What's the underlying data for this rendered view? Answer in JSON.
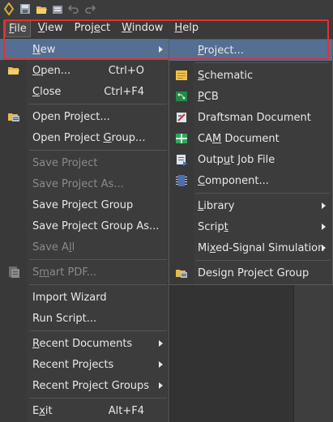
{
  "menubar": {
    "items": [
      {
        "pre": "",
        "u": "F",
        "post": "ile"
      },
      {
        "pre": "",
        "u": "V",
        "post": "iew"
      },
      {
        "pre": "Proj",
        "u": "e",
        "post": "ct"
      },
      {
        "pre": "",
        "u": "W",
        "post": "indow"
      },
      {
        "pre": "",
        "u": "H",
        "post": "elp"
      }
    ]
  },
  "file_menu": {
    "new": {
      "pre": "",
      "u": "N",
      "post": "ew"
    },
    "open": {
      "pre": "",
      "u": "O",
      "post": "pen...",
      "shortcut": "Ctrl+O"
    },
    "close": {
      "pre": "",
      "u": "C",
      "post": "lose",
      "shortcut": "Ctrl+F4"
    },
    "open_project": {
      "pre": "Open Pro",
      "u": "j",
      "post": "ect..."
    },
    "open_project_group": {
      "pre": "Open Project ",
      "u": "G",
      "post": "roup..."
    },
    "save_project": {
      "pre": "Save Project",
      "u": "",
      "post": ""
    },
    "save_project_as": {
      "pre": "Save Project As...",
      "u": "",
      "post": ""
    },
    "save_project_group": {
      "pre": "Save Project Group",
      "u": "",
      "post": ""
    },
    "save_project_group_as": {
      "pre": "Save Project Group As...",
      "u": "",
      "post": ""
    },
    "save_all": {
      "pre": "Save A",
      "u": "l",
      "post": "l"
    },
    "smart_pdf": {
      "pre": "S",
      "u": "m",
      "post": "art PDF..."
    },
    "import_wizard": {
      "pre": "Import Wizard",
      "u": "",
      "post": ""
    },
    "run_script": {
      "pre": "Run Script...",
      "u": "",
      "post": ""
    },
    "recent_documents": {
      "pre": "",
      "u": "R",
      "post": "ecent Documents"
    },
    "recent_projects": {
      "pre": "Recent Pro",
      "u": "j",
      "post": "ects"
    },
    "recent_project_groups": {
      "pre": "Recent Pro",
      "u": "j",
      "post": "ect Groups"
    },
    "exit": {
      "pre": "E",
      "u": "x",
      "post": "it",
      "shortcut": "Alt+F4"
    }
  },
  "new_submenu": {
    "project": {
      "pre": "",
      "u": "P",
      "post": "roject..."
    },
    "schematic": {
      "pre": "",
      "u": "S",
      "post": "chematic"
    },
    "pcb": {
      "pre": "",
      "u": "P",
      "post": "CB"
    },
    "draftsman": {
      "pre": "Draftsman Document",
      "u": "",
      "post": ""
    },
    "cam": {
      "pre": "CA",
      "u": "M",
      "post": " Document"
    },
    "output_job": {
      "pre": "Outp",
      "u": "u",
      "post": "t Job File"
    },
    "component": {
      "pre": "",
      "u": "C",
      "post": "omponent..."
    },
    "library": {
      "pre": "",
      "u": "L",
      "post": "ibrary"
    },
    "script": {
      "pre": "Scrip",
      "u": "t",
      "post": ""
    },
    "mixed_signal": {
      "pre": "Mi",
      "u": "x",
      "post": "ed-Signal Simulation"
    },
    "design_project_group": {
      "pre": "Design Project Group",
      "u": "",
      "post": ""
    }
  },
  "colors": {
    "highlight": "#556f92",
    "annotation": "#e53030"
  }
}
